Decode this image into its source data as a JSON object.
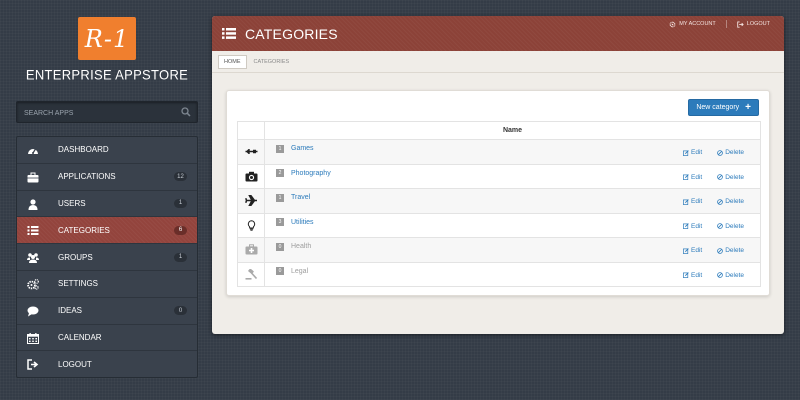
{
  "logo": {
    "text": "R-1"
  },
  "brand": {
    "title": "ENTERPRISE APPSTORE"
  },
  "search": {
    "placeholder": "SEARCH APPS",
    "icon": "search-icon"
  },
  "nav": {
    "items": [
      {
        "label": "DASHBOARD",
        "icon": "dashboard-icon",
        "badge": ""
      },
      {
        "label": "APPLICATIONS",
        "icon": "briefcase-icon",
        "badge": "12"
      },
      {
        "label": "USERS",
        "icon": "user-icon",
        "badge": "1"
      },
      {
        "label": "CATEGORIES",
        "icon": "list-icon",
        "badge": "6",
        "active": true
      },
      {
        "label": "GROUPS",
        "icon": "group-icon",
        "badge": "1"
      },
      {
        "label": "SETTINGS",
        "icon": "gears-icon",
        "badge": ""
      },
      {
        "label": "IDEAS",
        "icon": "speech-bubble-icon",
        "badge": "0"
      },
      {
        "label": "CALENDAR",
        "icon": "calendar-icon",
        "badge": ""
      },
      {
        "label": "LOGOUT",
        "icon": "sign-out-icon",
        "badge": ""
      }
    ]
  },
  "header": {
    "title": "CATEGORIES",
    "my_account": "MY ACCOUNT",
    "logout": "LOGOUT"
  },
  "breadcrumb": {
    "home": "HOME",
    "current": "CATEGORIES"
  },
  "toolbar": {
    "new_label": "New category",
    "new_icon": "+"
  },
  "table": {
    "header": "Name",
    "edit_label": "Edit",
    "delete_label": "Delete",
    "rows": [
      {
        "icon": "gamepad-icon",
        "count": "1",
        "name": "Games",
        "enabled": true
      },
      {
        "icon": "camera-icon",
        "count": "2",
        "name": "Photography",
        "enabled": true
      },
      {
        "icon": "plane-icon",
        "count": "1",
        "name": "Travel",
        "enabled": true
      },
      {
        "icon": "lightbulb-icon",
        "count": "3",
        "name": "Utilities",
        "enabled": true
      },
      {
        "icon": "medkit-icon",
        "count": "0",
        "name": "Health",
        "enabled": false
      },
      {
        "icon": "gavel-icon",
        "count": "0",
        "name": "Legal",
        "enabled": false
      }
    ]
  },
  "colors": {
    "accent": "#8c4238",
    "nav_active": "#93443d",
    "link": "#2c7bbb",
    "logo": "#f07f2e",
    "background": "#343c47"
  }
}
